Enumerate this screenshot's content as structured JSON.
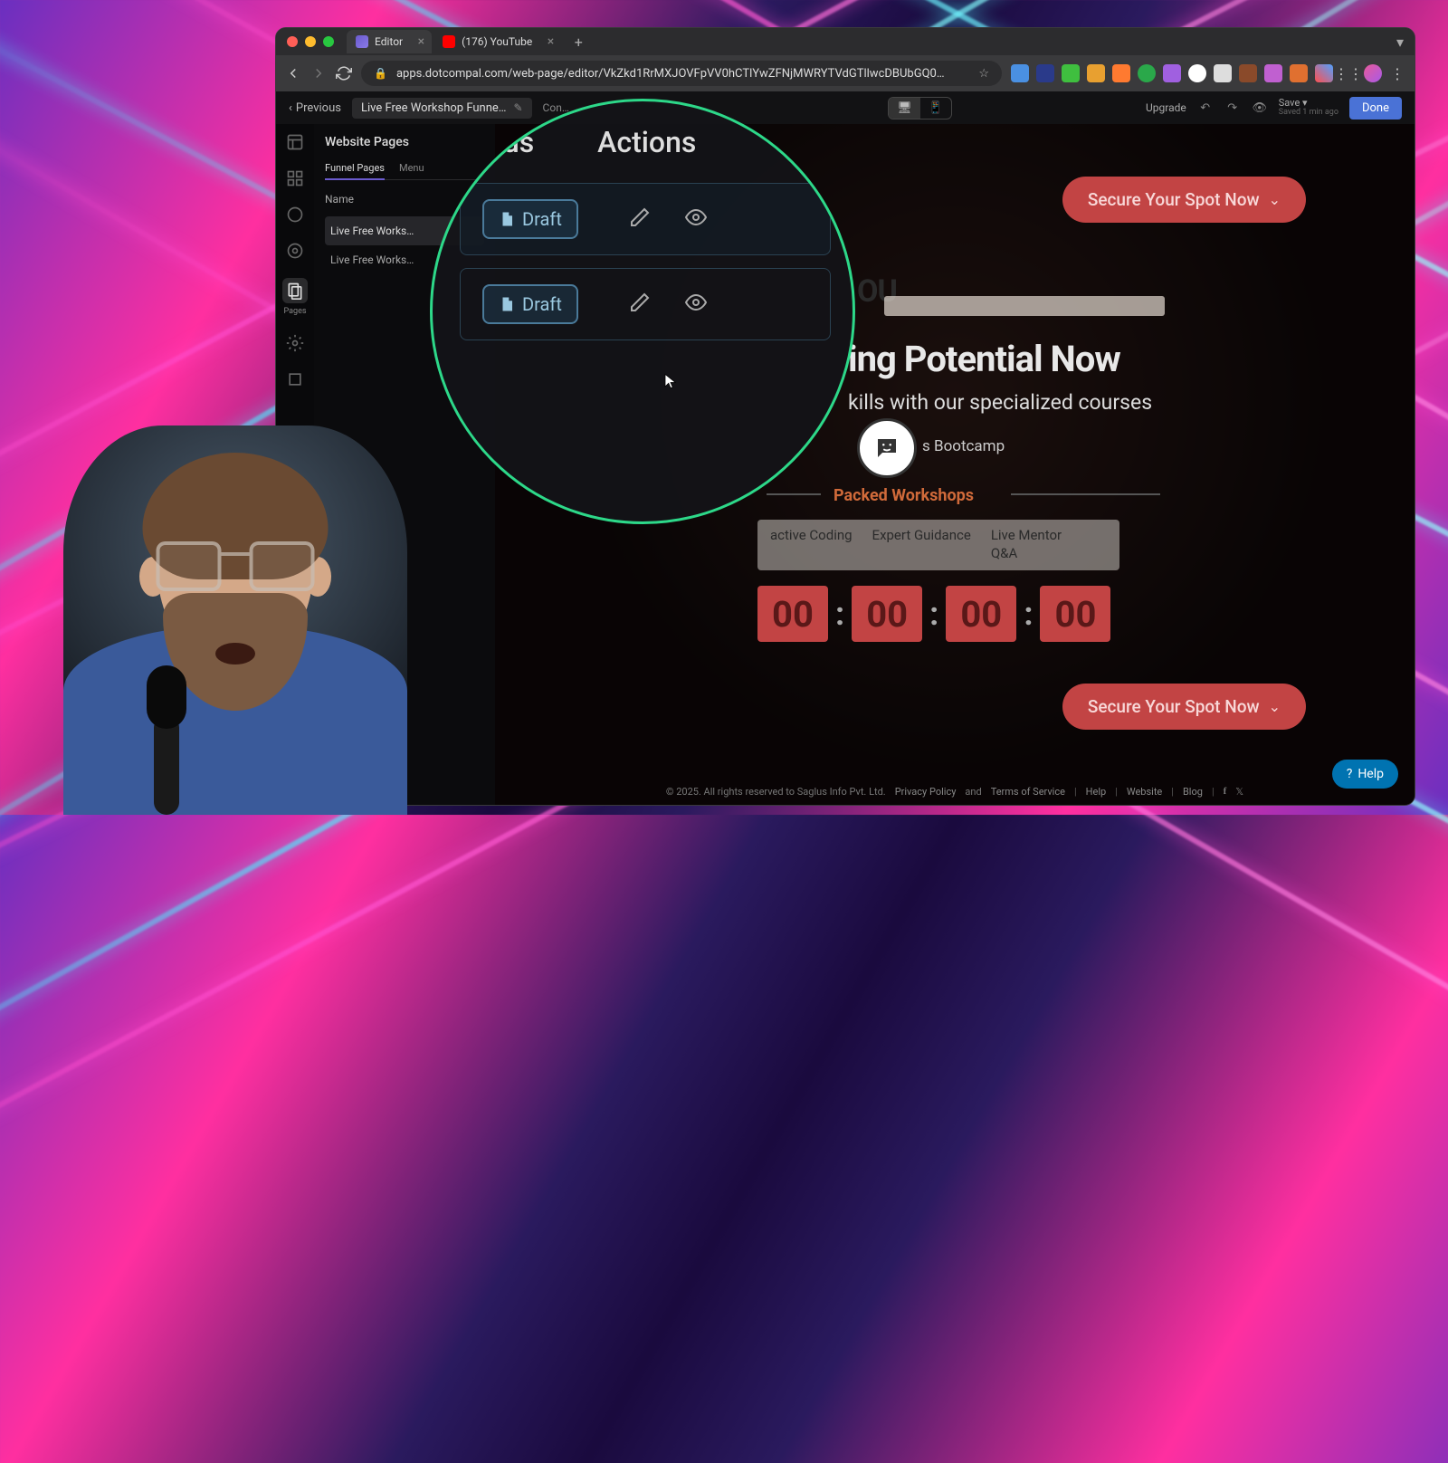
{
  "browser": {
    "tabs": [
      {
        "title": "Editor",
        "favicon": "dotcompal"
      },
      {
        "title": "(176) YouTube",
        "favicon": "youtube"
      }
    ],
    "url": "apps.dotcompal.com/web-page/editor/VkZkd1RrMXJOVFpVV0hCTlYwZFNjMWRYTVdGTllwcDBUbGQ0…"
  },
  "app": {
    "previous": "Previous",
    "page_title": "Live Free Workshop Funne…",
    "conn": "Con…",
    "upgrade": "Upgrade",
    "save_label": "Save",
    "save_menu_indicator": "▾",
    "saved_hint": "Saved 1 min ago",
    "done": "Done"
  },
  "rail": {
    "pages_label": "Pages"
  },
  "side_panel": {
    "heading": "Website Pages",
    "subtabs": [
      "Funnel Pages",
      "Menu"
    ],
    "name_col": "Name",
    "rows": [
      "Live Free Works…",
      "Live Free Works…"
    ]
  },
  "magnifier": {
    "status_header": "atus",
    "actions_header": "Actions",
    "draft_label": "Draft"
  },
  "canvas": {
    "cta": "Secure Your Spot Now",
    "ou_frag": "OU",
    "headline_frag": "ing Potential Now",
    "subhead_frag": "kills with our specialized courses",
    "bootcamp_frag": "s Bootcamp",
    "packed_label": "Packed Workshops",
    "features": [
      "active Coding",
      "Expert Guidance",
      "Live Mentor Q&A"
    ],
    "countdown": [
      "00",
      "00",
      "00",
      "00"
    ]
  },
  "footer": {
    "copyright": "© 2025. All rights reserved to Saglus Info Pvt. Ltd.",
    "privacy": "Privacy Policy",
    "and": "and",
    "terms": "Terms of Service",
    "help": "Help",
    "website": "Website",
    "blog": "Blog"
  },
  "help_pill": "Help"
}
